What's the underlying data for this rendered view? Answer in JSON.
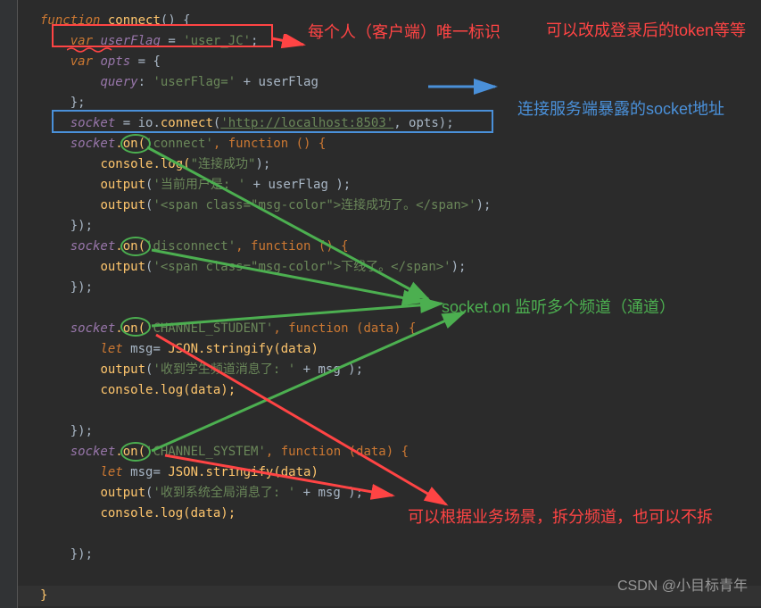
{
  "code": {
    "l1_fn": "function",
    "l1_name": "connect",
    "l1_rest": "() {",
    "l2_var": "var",
    "l2_id": "userFlag",
    "l2_eq": " = ",
    "l2_str": "'user_JC'",
    "l2_end": ";",
    "l3_var": "var",
    "l3_id": "opts",
    "l3_rest": " = {",
    "l4_key": "query",
    "l4_rest": ": ",
    "l4_str": "'userFlag='",
    "l4_plus": " + userFlag",
    "l5": "};",
    "l6_id": "socket",
    "l6_eq": " = io.",
    "l6_fn": "connect",
    "l6_p1": "(",
    "l6_url": "'http://localhost:8503'",
    "l6_rest": ", opts);",
    "l7_id": "socket",
    "l7_on": ".on(",
    "l7_str": "'connect'",
    "l7_fn": ", function () {",
    "l8_obj": "console",
    "l8_fn": ".log(",
    "l8_str": "\"连接成功\"",
    "l8_end": ");",
    "l9_fn": "output",
    "l9_p": "(",
    "l9_str": "'当前用户是: '",
    "l9_rest": " + userFlag );",
    "l10_fn": "output",
    "l10_p": "(",
    "l10_str": "'<span class=\"msg-color\">连接成功了。</span>'",
    "l10_end": ");",
    "l11": "});",
    "l12_id": "socket",
    "l12_on": ".on(",
    "l12_str": "'disconnect'",
    "l12_fn": ", function () {",
    "l13_fn": "output",
    "l13_p": "(",
    "l13_str": "'<span class=\"msg-color\">下线了。</span>'",
    "l13_end": ");",
    "l14": "});",
    "l16_id": "socket",
    "l16_on": ".on(",
    "l16_str": "'CHANNEL_STUDENT'",
    "l16_fn": ", function (data) {",
    "l17_let": "let",
    "l17_id": " msg= ",
    "l17_obj": "JSON",
    "l17_fn": ".stringify(data)",
    "l18_fn": "output",
    "l18_p": "(",
    "l18_str": "'收到学生频道消息了: '",
    "l18_rest": " + msg );",
    "l19_obj": "console",
    "l19_fn": ".log(data);",
    "l21": "});",
    "l22_id": "socket",
    "l22_on": ".on(",
    "l22_str": "'CHANNEL_SYSTEM'",
    "l22_fn": ", function (data) {",
    "l23_let": "let",
    "l23_id": " msg= ",
    "l23_obj": "JSON",
    "l23_fn": ".stringify(data)",
    "l24_fn": "output",
    "l24_p": "(",
    "l24_str": "'收到系统全局消息了: '",
    "l24_rest": " + msg );",
    "l25_obj": "console",
    "l25_fn": ".log(data);",
    "l27": "});",
    "l_close": "}"
  },
  "annotations": {
    "a1": "每个人（客户端）唯一标识",
    "a2": "可以改成登录后的token等等",
    "a3": "连接服务端暴露的socket地址",
    "a4": "socket.on 监听多个频道（通道）",
    "a5": "可以根据业务场景，拆分频道，也可以不拆"
  },
  "watermark": "CSDN @小目标青年"
}
